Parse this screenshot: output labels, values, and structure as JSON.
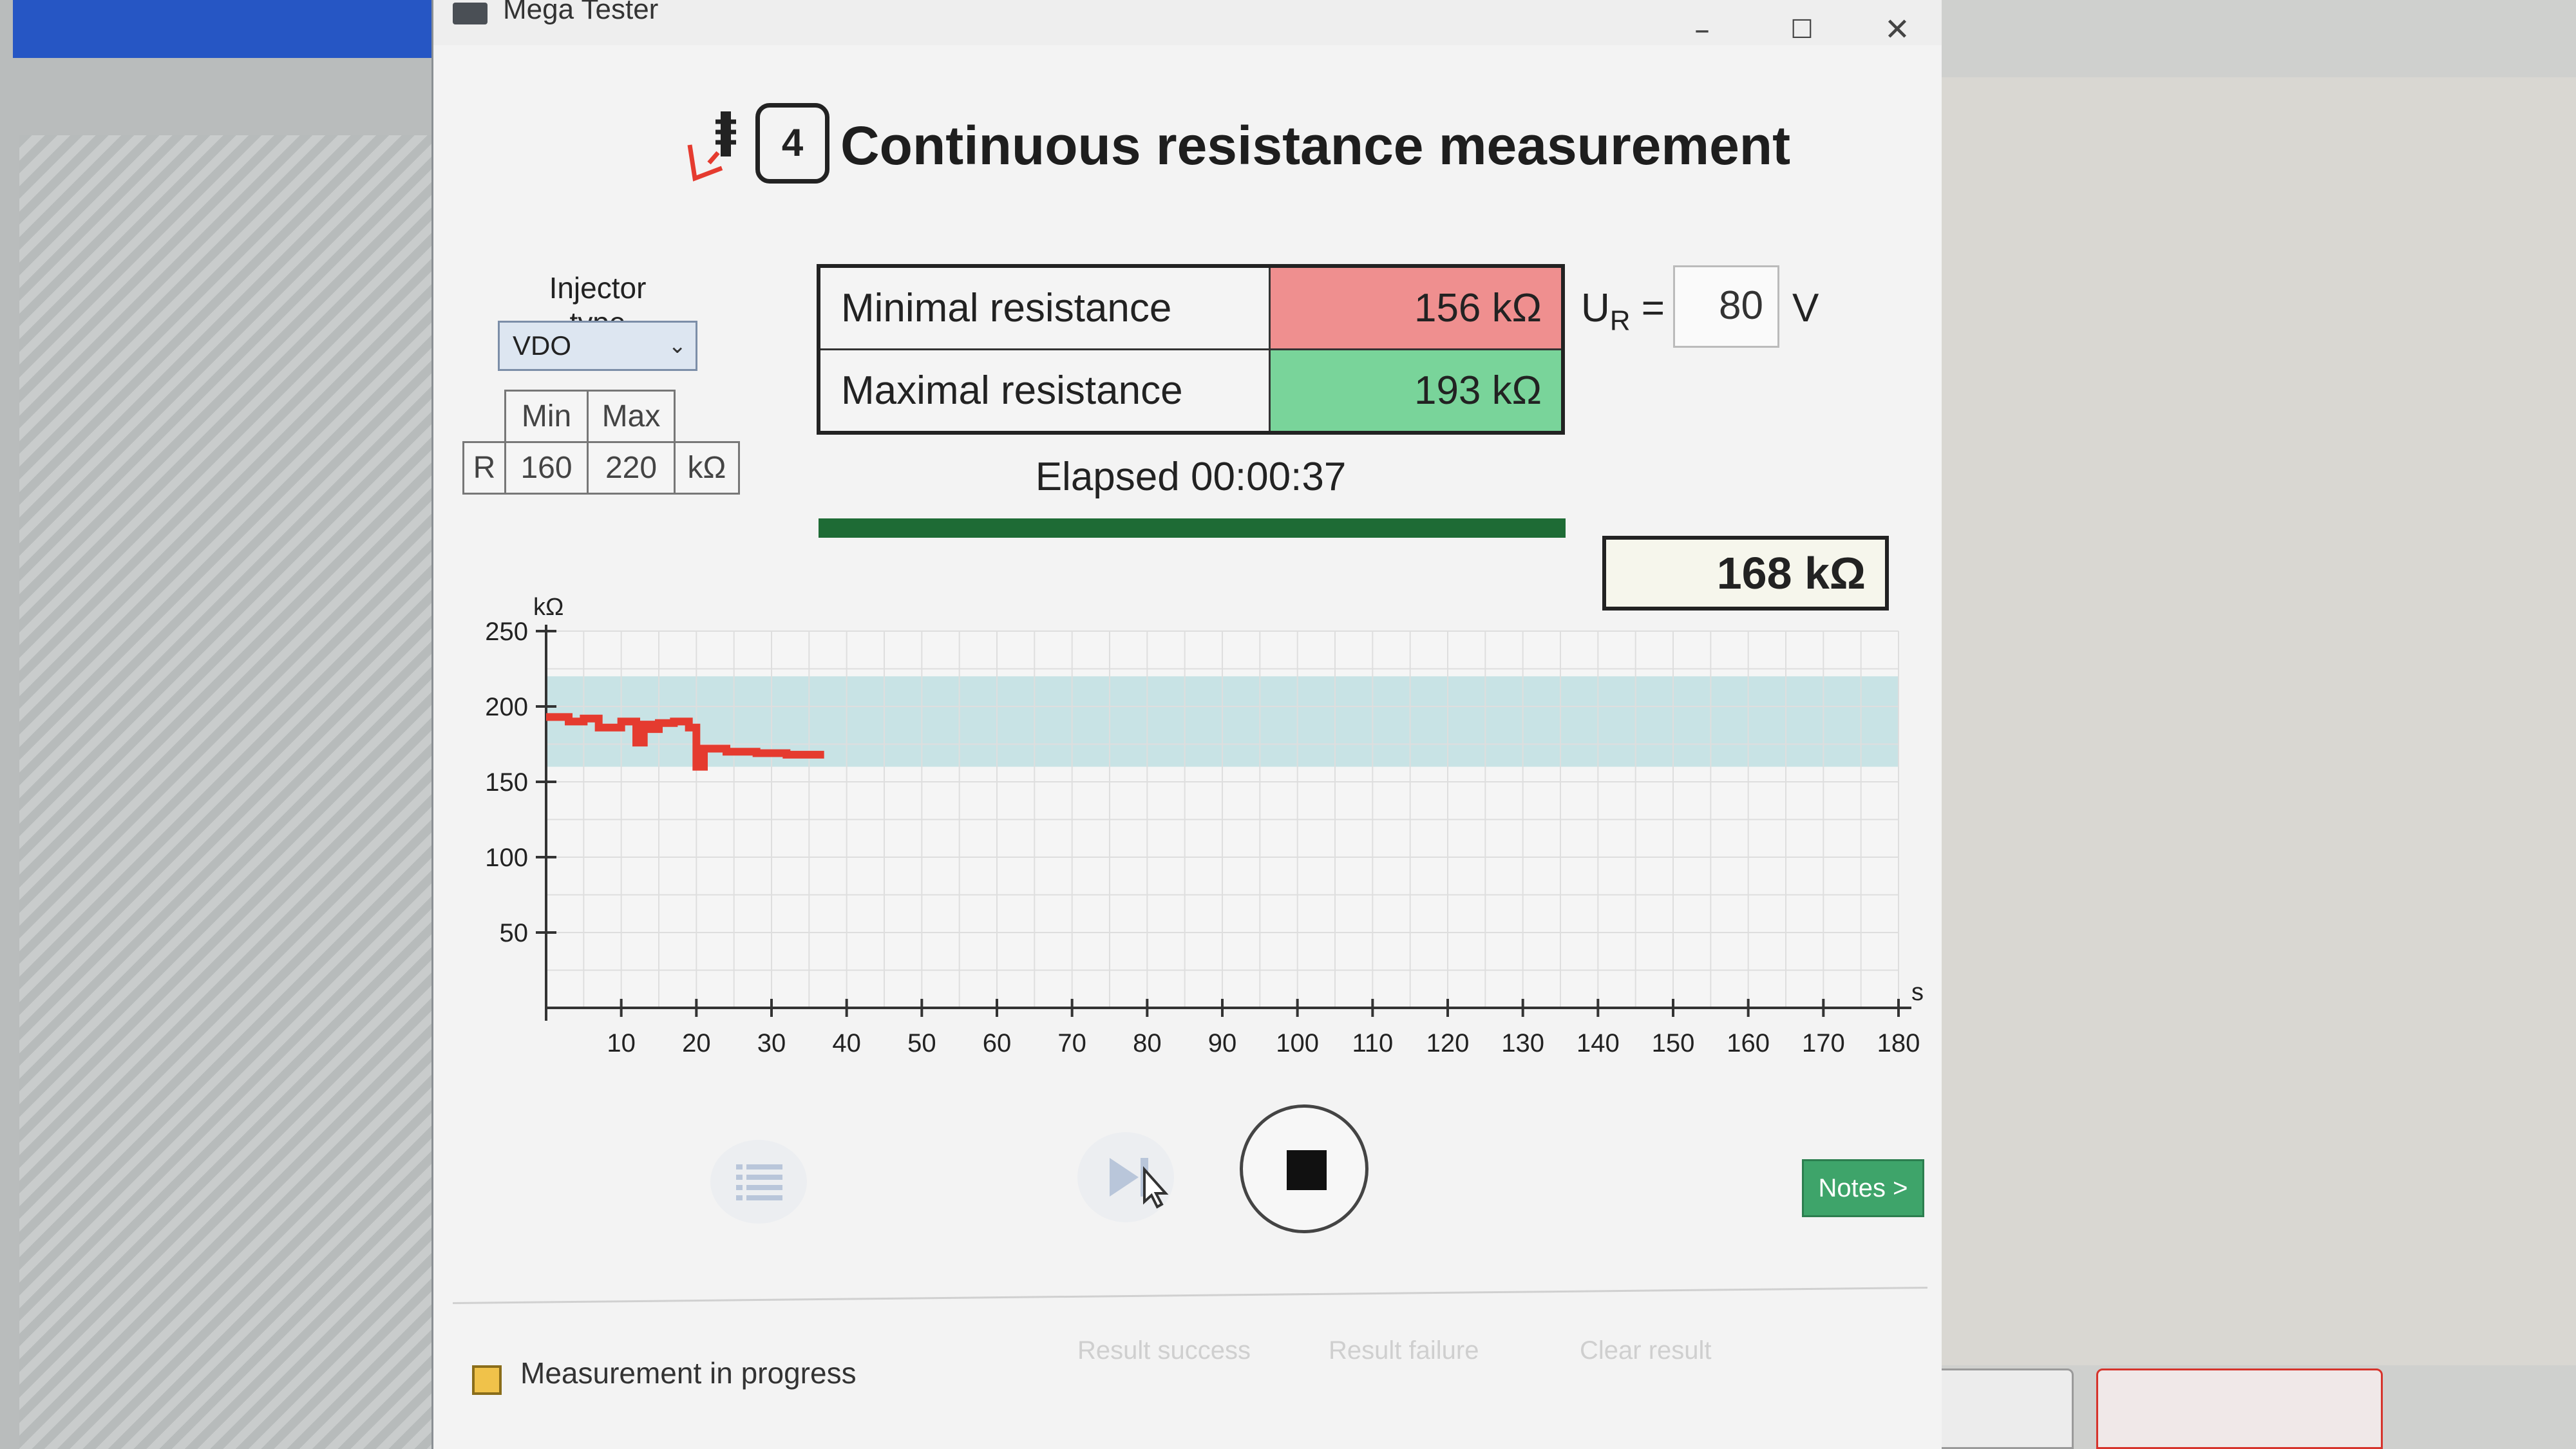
{
  "window": {
    "title": "Mega Tester"
  },
  "header": {
    "step": "4",
    "title": "Continuous resistance measurement"
  },
  "injector": {
    "label": "Injector type",
    "selected": "VDO",
    "range": {
      "col_min": "Min",
      "col_max": "Max",
      "row_label": "R",
      "min": "160",
      "max": "220",
      "unit": "kΩ"
    }
  },
  "measurement": {
    "min_label": "Minimal resistance",
    "min_value": "156 kΩ",
    "max_label": "Maximal resistance",
    "max_value": "193 kΩ",
    "ur_label": "U",
    "ur_sub": "R",
    "ur_eq": "=",
    "ur_value": "80",
    "ur_unit": "V",
    "elapsed": "Elapsed 00:00:37",
    "progress": 1.0,
    "current": "168 kΩ"
  },
  "chart_data": {
    "type": "line",
    "ylabel": "kΩ",
    "xlabel": "s",
    "xlim": [
      0,
      180
    ],
    "ylim": [
      0,
      250
    ],
    "xticks": [
      10,
      20,
      30,
      40,
      50,
      60,
      70,
      80,
      90,
      100,
      110,
      120,
      130,
      140,
      150,
      160,
      170,
      180
    ],
    "yticks": [
      50,
      100,
      150,
      200,
      250
    ],
    "tolerance_band": [
      160,
      220
    ],
    "grid": true,
    "series": [
      {
        "x": [
          0,
          3,
          3,
          5,
          5,
          7,
          7,
          10,
          10,
          12,
          12,
          13,
          13,
          14,
          14,
          15,
          15,
          17,
          17,
          19,
          19,
          20,
          20,
          21,
          21,
          24,
          24,
          28,
          28,
          32,
          32,
          36,
          37
        ],
        "y": [
          193,
          193,
          190,
          190,
          192,
          192,
          186,
          186,
          190,
          190,
          176,
          176,
          188,
          188,
          185,
          185,
          189,
          189,
          190,
          190,
          186,
          186,
          160,
          160,
          172,
          172,
          170,
          170,
          169,
          169,
          168,
          168,
          168
        ]
      }
    ]
  },
  "controls": {
    "notes": "Notes >",
    "status": "Measurement in progress",
    "result_success": "Result success",
    "result_failure": "Result failure",
    "clear_result": "Clear result"
  },
  "colors": {
    "min_bg": "#ef8f8f",
    "max_bg": "#79d49a",
    "progress": "#1e6b35",
    "trace": "#e53b2f",
    "band": "#b8dcdf",
    "notes_bg": "#3ea46a"
  }
}
